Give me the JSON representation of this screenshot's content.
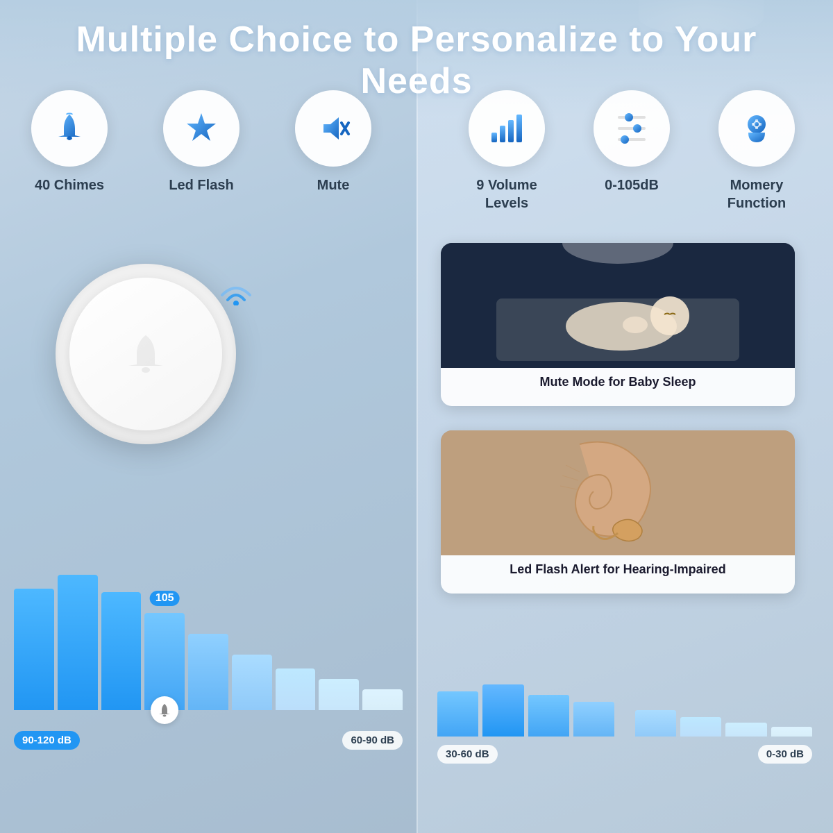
{
  "header": {
    "title": "Multiple Choice to Personalize to Your Needs"
  },
  "features_left": [
    {
      "id": "chimes",
      "label": "40 Chimes",
      "icon": "bell"
    },
    {
      "id": "led-flash",
      "label": "Led Flash",
      "icon": "star"
    },
    {
      "id": "mute",
      "label": "Mute",
      "icon": "mute"
    }
  ],
  "features_right": [
    {
      "id": "volume-levels",
      "label": "9 Volume\nLevels",
      "icon": "bars"
    },
    {
      "id": "db-range",
      "label": "0-105dB",
      "icon": "equalizer"
    },
    {
      "id": "memory",
      "label": "Momery\nFunction",
      "icon": "head"
    }
  ],
  "cards": [
    {
      "id": "baby-sleep",
      "caption": "Mute Mode for Baby Sleep"
    },
    {
      "id": "hearing-impaired",
      "caption": "Led Flash Alert for Hearing-Impaired"
    }
  ],
  "volume_indicator": "105",
  "db_labels_left": [
    "90-120 dB",
    "60-90 dB"
  ],
  "db_labels_right": [
    "30-60 dB",
    "0-30 dB"
  ]
}
